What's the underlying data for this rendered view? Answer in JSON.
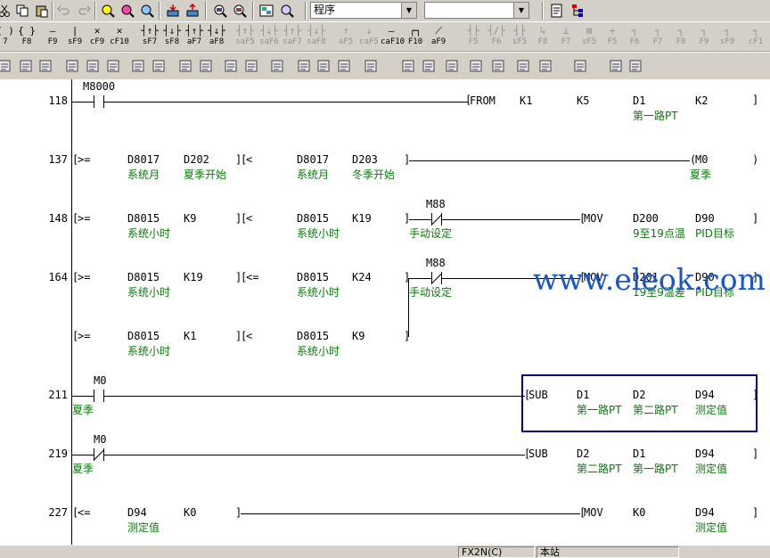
{
  "toolbar": {
    "mode_select": "程序",
    "second_select": "",
    "fkeys": [
      {
        "sym": "( )",
        "lbl": "7"
      },
      {
        "sym": "{ }",
        "lbl": "F8"
      },
      {
        "sym": "—",
        "lbl": "F9"
      },
      {
        "sym": "|",
        "lbl": "sF9"
      },
      {
        "sym": "✕",
        "lbl": "cF9"
      },
      {
        "sym": "✕",
        "lbl": "cF10"
      },
      {
        "sym": "┤↑├",
        "lbl": "sF7"
      },
      {
        "sym": "┤↓├",
        "lbl": "sF8"
      },
      {
        "sym": "┤↑├",
        "lbl": "aF7"
      },
      {
        "sym": "┤↓├",
        "lbl": "aF8"
      },
      {
        "sym": "┤↑├",
        "lbl": "saF5"
      },
      {
        "sym": "┤↓├",
        "lbl": "saF6"
      },
      {
        "sym": "┤↑├",
        "lbl": "saF7"
      },
      {
        "sym": "┤↓├",
        "lbl": "saF8"
      },
      {
        "sym": "↑",
        "lbl": "aF5"
      },
      {
        "sym": "↓",
        "lbl": "caF5"
      },
      {
        "sym": "—",
        "lbl": "caF10"
      },
      {
        "sym": "┌┐",
        "lbl": "F10"
      },
      {
        "sym": "⟋",
        "lbl": "aF9"
      },
      {
        "sym": "┤├",
        "lbl": "F5"
      },
      {
        "sym": "┤/├",
        "lbl": "F6"
      },
      {
        "sym": "┤├",
        "lbl": "sF5"
      },
      {
        "sym": "↳",
        "lbl": "F8"
      },
      {
        "sym": "⊥",
        "lbl": "F7"
      },
      {
        "sym": "⊠",
        "lbl": "sF5"
      },
      {
        "sym": "+",
        "lbl": "F5"
      },
      {
        "sym": "┐",
        "lbl": "F6"
      },
      {
        "sym": "┐",
        "lbl": "F7"
      },
      {
        "sym": "┐",
        "lbl": "F8"
      },
      {
        "sym": "┐",
        "lbl": "F9"
      },
      {
        "sym": "┐",
        "lbl": "sF9"
      },
      {
        "sym": "┐",
        "lbl": "cF1"
      }
    ]
  },
  "ladder": {
    "steps": [
      {
        "num": "118",
        "contact": "M8000",
        "instr": "FROM",
        "a1": "K1",
        "a2": "K5",
        "a3": "D1",
        "a4": "K2",
        "c3": "第一路PT"
      },
      {
        "num": "137",
        "cmp1": ">=",
        "d1": "D8017",
        "d2": "D202",
        "c1": "系统月",
        "c2": "夏季开始",
        "cmp2": "<",
        "d3": "D8017",
        "d4": "D203",
        "c3": "系统月",
        "c4": "冬季开始",
        "out": "M0",
        "cout": "夏季"
      },
      {
        "num": "148",
        "cmp1": ">=",
        "d1": "D8015",
        "d2": "K9",
        "c1": "系统小时",
        "cmp2": "<",
        "d3": "D8015",
        "d4": "K19",
        "c3": "系统小时",
        "contact": "M88",
        "ccontact": "手动设定",
        "instr": "MOV",
        "a1": "D200",
        "a2": "D90",
        "ca1": "9至19点温",
        "ca2": "PID目标"
      },
      {
        "num": "164",
        "cmp1": ">=",
        "d1": "D8015",
        "d2": "K19",
        "c1": "系统小时",
        "cmp2": "<=",
        "d3": "D8015",
        "d4": "K24",
        "c3": "系统小时",
        "contact": "M88",
        "ccontact": "手动设定",
        "instr": "MOV",
        "a1": "D201",
        "a2": "D90",
        "ca1": "19至9温差",
        "ca2": "PID目标"
      },
      {
        "num": "",
        "cmp1": ">=",
        "d1": "D8015",
        "d2": "K1",
        "c1": "系统小时",
        "cmp2": "<",
        "d3": "D8015",
        "d4": "K9",
        "c3": "系统小时"
      },
      {
        "num": "211",
        "contact": "M0",
        "ccontact": "夏季",
        "instr": "SUB",
        "a1": "D1",
        "a2": "D2",
        "a3": "D94",
        "ca1": "第一路PT",
        "ca2": "第二路PT",
        "ca3": "测定值"
      },
      {
        "num": "219",
        "contact": "M0",
        "ccontact": "夏季",
        "instr": "SUB",
        "a1": "D2",
        "a2": "D1",
        "a3": "D94",
        "ca1": "第二路PT",
        "ca2": "第一路PT",
        "ca3": "测定值"
      },
      {
        "num": "227",
        "cmp1": "<=",
        "d1": "D94",
        "d2": "K0",
        "c1": "测定值",
        "instr": "MOV",
        "a1": "K0",
        "a2": "D94",
        "ca2": "测定值"
      }
    ]
  },
  "watermark": "www.eleok.com",
  "status": {
    "plc": "FX2N(C)",
    "station": "本站"
  }
}
